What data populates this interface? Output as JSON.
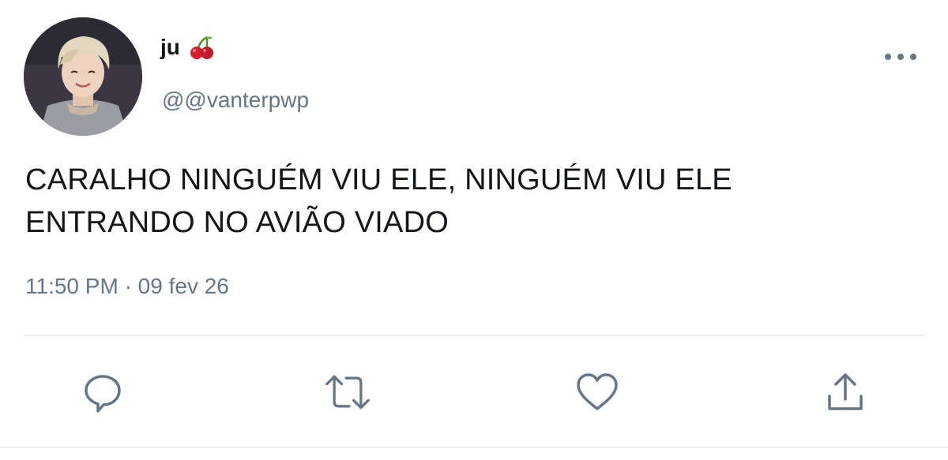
{
  "tweet": {
    "display_name": "ju",
    "name_emoji_icon": "cherries-icon",
    "handle": "@@vanterpwp",
    "text_line1": "CARALHO NINGUÉM VIU ELE, NINGUÉM VIU ELE",
    "text_line2": "ENTRANDO NO AVIÃO VIADO",
    "time": "11:50 PM",
    "separator": "·",
    "date": "09 fev 26"
  },
  "actions": [
    {
      "icon": "reply-icon"
    },
    {
      "icon": "retweet-icon"
    },
    {
      "icon": "like-icon"
    },
    {
      "icon": "share-icon"
    }
  ],
  "colors": {
    "text": "#14171a",
    "secondary": "#657786",
    "icon": "#657786",
    "divider": "#e6ecf0"
  }
}
